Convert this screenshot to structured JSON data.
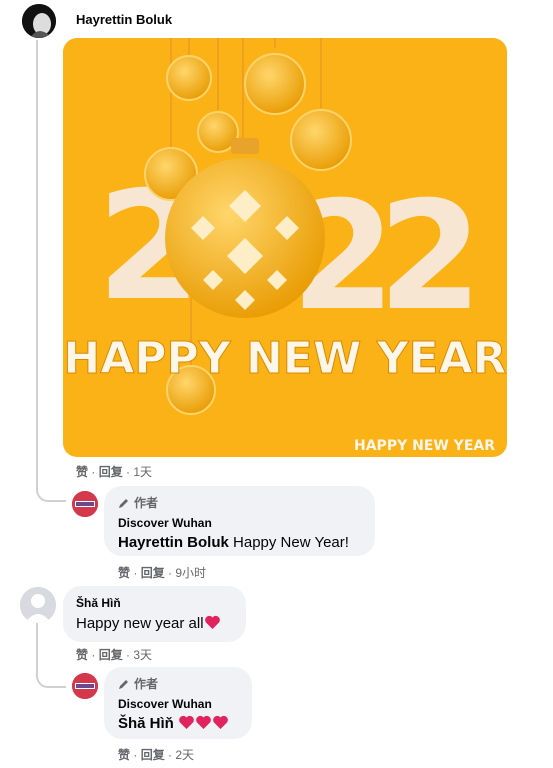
{
  "comments": [
    {
      "author": "Hayrettin Boluk",
      "image_label": "HAPPY NEW YEAR",
      "image_year_digits": [
        "2",
        "0",
        "2",
        "2"
      ],
      "image_caption": "HAPPY NEW YEAR",
      "actions": {
        "like": "赞",
        "reply": "回复",
        "time": "1天"
      },
      "reply": {
        "author_tag": "作者",
        "author": "Discover Wuhan",
        "mention": "Hayrettin Boluk",
        "text": " Happy New Year!",
        "actions": {
          "like": "赞",
          "reply": "回复",
          "time": "9小时"
        }
      }
    },
    {
      "author": "Šhă Hìň",
      "text": "Happy new year all",
      "actions": {
        "like": "赞",
        "reply": "回复",
        "time": "3天"
      },
      "reply": {
        "author_tag": "作者",
        "author": "Discover Wuhan",
        "mention": "Šhă Hìň",
        "actions": {
          "like": "赞",
          "reply": "回复",
          "time": "2天"
        }
      }
    }
  ],
  "colors": {
    "image_bg": "#fbb217",
    "heart": "#e0245e",
    "bubble": "#f0f2f5"
  }
}
